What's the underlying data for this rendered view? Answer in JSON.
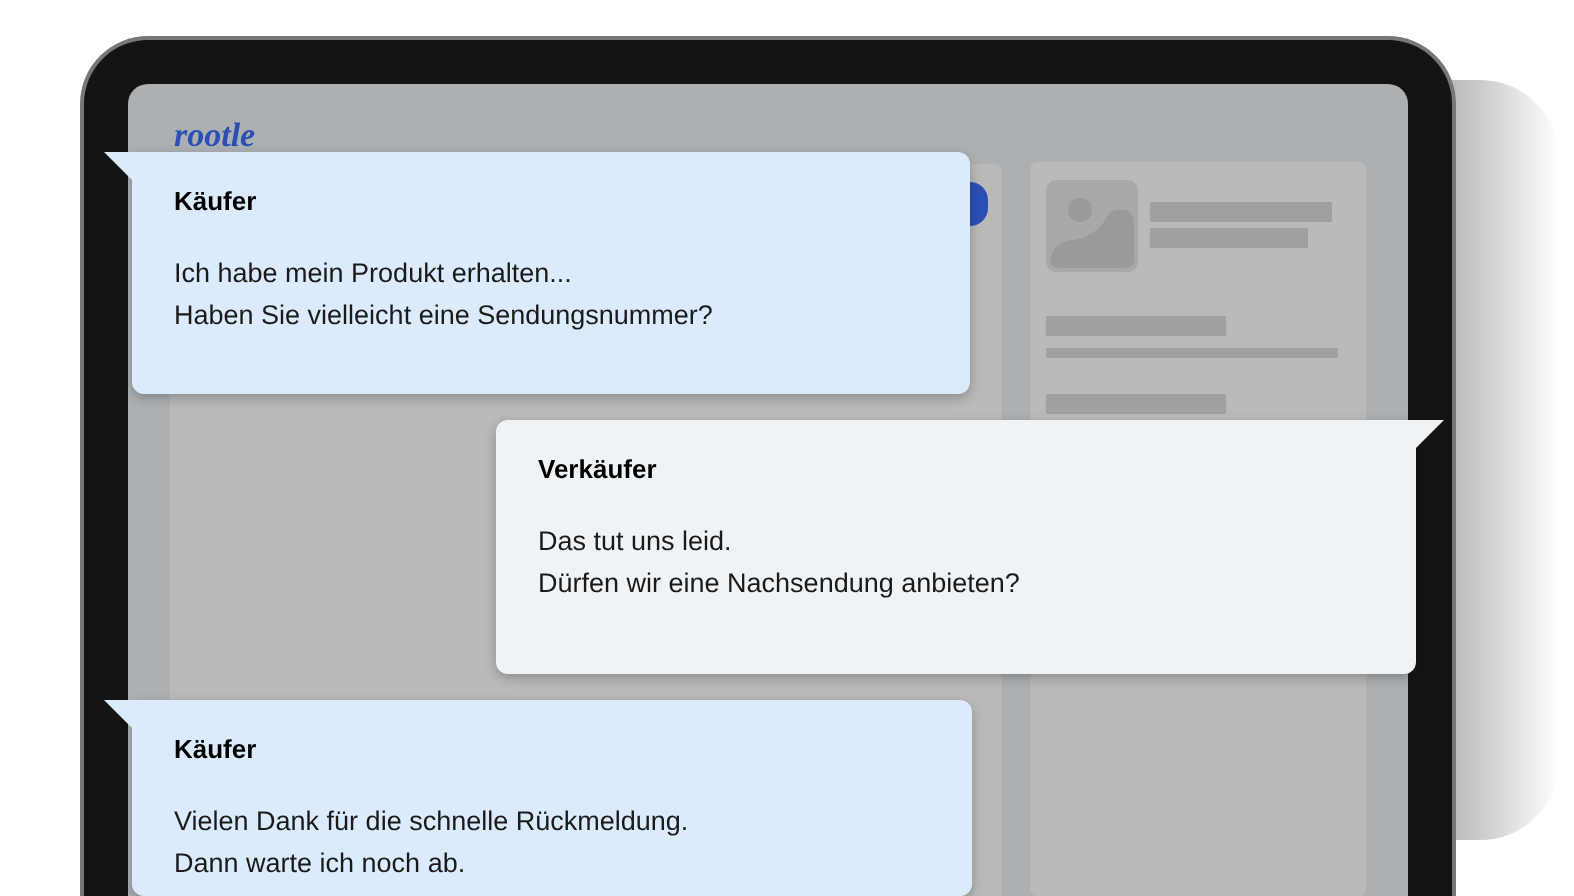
{
  "logo": "rootle",
  "messages": [
    {
      "kind": "buyer",
      "sender": "Käufer",
      "text": "Ich habe mein Produkt erhalten...\nHaben Sie vielleicht eine Sendungsnummer?"
    },
    {
      "kind": "seller",
      "sender": "Verkäufer",
      "text": "Das tut uns leid.\nDürfen wir eine Nachsendung anbieten?"
    },
    {
      "kind": "buyer",
      "sender": "Käufer",
      "text": "Vielen Dank für die schnelle Rückmeldung.\nDann warte ich noch ab."
    }
  ]
}
